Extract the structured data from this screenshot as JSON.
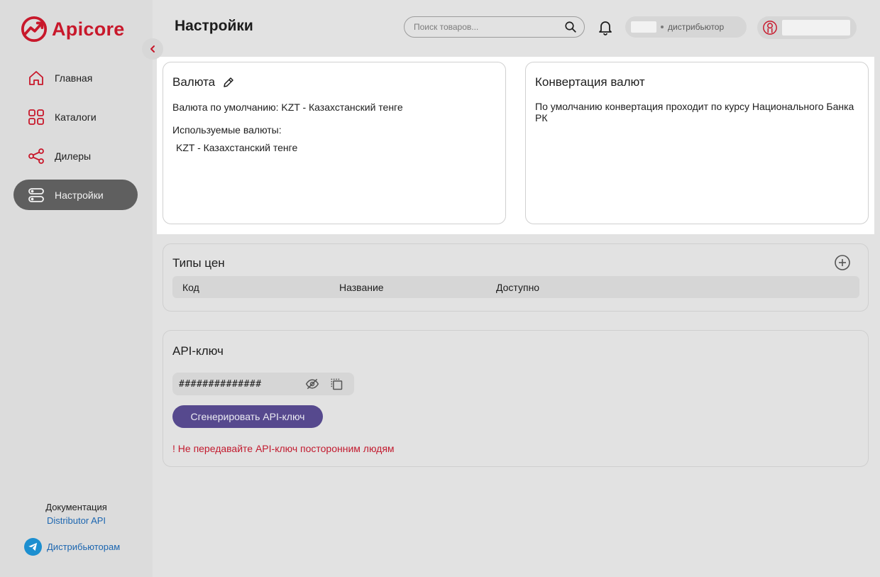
{
  "brand": {
    "name": "Apicore",
    "color": "#c8182b"
  },
  "sidebar": {
    "items": [
      {
        "label": "Главная",
        "icon": "home-icon"
      },
      {
        "label": "Каталоги",
        "icon": "grid-icon"
      },
      {
        "label": "Дилеры",
        "icon": "share-icon"
      },
      {
        "label": "Настройки",
        "icon": "server-icon",
        "active": true
      }
    ],
    "docs_label": "Документация",
    "docs_link": "Distributor API",
    "telegram_label": "Дистрибьюторам"
  },
  "header": {
    "title": "Настройки",
    "search_placeholder": "Поиск товаров...",
    "role": "дистрибьютор"
  },
  "currency_card": {
    "title": "Валюта",
    "default_line": "Валюта по умолчанию: KZT - Казахстанский тенге",
    "used_label": "Используемые валюты:",
    "used_items": [
      "KZT - Казахстанский тенге"
    ]
  },
  "conversion_card": {
    "title": "Конвертация валют",
    "text": "По умолчанию конвертация проходит по курсу Национального Банка РК"
  },
  "price_types": {
    "title": "Типы цен",
    "columns": [
      "Код",
      "Название",
      "Доступно"
    ]
  },
  "api_key": {
    "title": "API-ключ",
    "masked_value": "##############",
    "generate_button": "Сгенерировать API-ключ",
    "warning": "! Не передавайте API-ключ посторонним людям",
    "button_color": "#56498e",
    "warning_color": "#c21a2e"
  }
}
